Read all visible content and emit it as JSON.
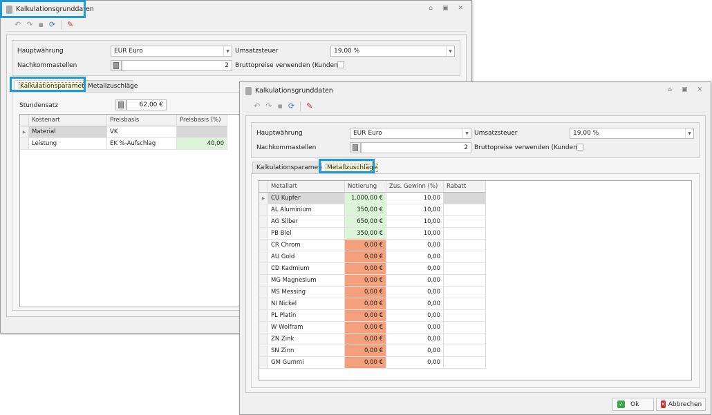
{
  "window_back": {
    "title": "Kalkulationsgrunddaten",
    "hauptwaehrung_label": "Hauptwährung",
    "hauptwaehrung_value": "EUR Euro",
    "umsatzsteuer_label": "Umsatzsteuer",
    "umsatzsteuer_value": "19,00 %",
    "nachkommastellen_label": "Nachkommastellen",
    "nachkommastellen_value": "2",
    "brutto_label": "Bruttopreise verwenden (Kunden)",
    "tabs": [
      "Kalkulationsparameter",
      "Metallzuschläge"
    ],
    "stundensatz_label": "Stundensatz",
    "stundensatz_value": "62,00 €",
    "columns": [
      "Kostenart",
      "Preisbasis",
      "Preisbasis (%)"
    ],
    "rows": [
      [
        "Material",
        "VK",
        ""
      ],
      [
        "Leistung",
        "EK %-Aufschlag",
        "40,00"
      ]
    ]
  },
  "window_front": {
    "title": "Kalkulationsgrunddaten",
    "hauptwaehrung_label": "Hauptwährung",
    "hauptwaehrung_value": "EUR Euro",
    "umsatzsteuer_label": "Umsatzsteuer",
    "umsatzsteuer_value": "19,00 %",
    "nachkommastellen_label": "Nachkommastellen",
    "nachkommastellen_value": "2",
    "brutto_label": "Bruttopreise verwenden (Kunden)",
    "tabs": [
      "Kalkulationsparameter",
      "Metallzuschläge"
    ],
    "columns": [
      "Metallart",
      "Notierung",
      "Zus. Gewinn (%)",
      "Rabatt"
    ],
    "rows": [
      [
        "CU Kupfer",
        "1.000,00 €",
        "10,00",
        ""
      ],
      [
        "AL Aluminium",
        "350,00 €",
        "10,00",
        ""
      ],
      [
        "AG Silber",
        "650,00 €",
        "10,00",
        ""
      ],
      [
        "PB Blei",
        "350,00 €",
        "10,00",
        ""
      ],
      [
        "CR Chrom",
        "0,00 €",
        "0,00",
        ""
      ],
      [
        "AU Gold",
        "0,00 €",
        "0,00",
        ""
      ],
      [
        "CD Kadmium",
        "0,00 €",
        "0,00",
        ""
      ],
      [
        "MG Magnesium",
        "0,00 €",
        "0,00",
        ""
      ],
      [
        "MS Messing",
        "0,00 €",
        "0,00",
        ""
      ],
      [
        "NI Nickel",
        "0,00 €",
        "0,00",
        ""
      ],
      [
        "PL Platin",
        "0,00 €",
        "0,00",
        ""
      ],
      [
        "W Wolfram",
        "0,00 €",
        "0,00",
        ""
      ],
      [
        "ZN Zink",
        "0,00 €",
        "0,00",
        ""
      ],
      [
        "SN Zinn",
        "0,00 €",
        "0,00",
        ""
      ],
      [
        "GM Gummi",
        "0,00 €",
        "0,00",
        ""
      ]
    ],
    "ok_label": "Ok",
    "cancel_label": "Abbrechen"
  },
  "colors": {
    "highlight": "#1e9ad6",
    "positive": "#dcf5d8",
    "zero": "#f4a07c"
  }
}
